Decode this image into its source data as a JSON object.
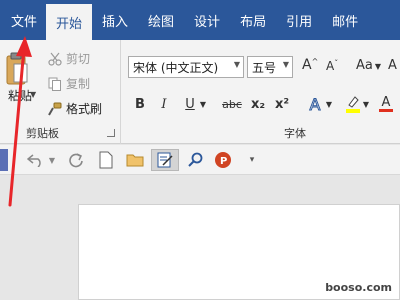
{
  "tabs": [
    {
      "label": "文件"
    },
    {
      "label": "开始"
    },
    {
      "label": "插入"
    },
    {
      "label": "绘图"
    },
    {
      "label": "设计"
    },
    {
      "label": "布局"
    },
    {
      "label": "引用"
    },
    {
      "label": "邮件"
    }
  ],
  "clipboard": {
    "paste_label": "粘贴",
    "cut_label": "剪切",
    "copy_label": "复制",
    "format_painter_label": "格式刷",
    "group_label": "剪贴板"
  },
  "font": {
    "font_name": "宋体 (中文正文)",
    "font_size": "五号",
    "grow_label": "A",
    "shrink_label": "A",
    "change_case_label": "Aa",
    "bold_label": "B",
    "italic_label": "I",
    "underline_label": "U",
    "strikethrough_label": "abc",
    "subscript_label": "x₂",
    "superscript_label": "x²",
    "text_effects_label": "A",
    "font_color_label": "A",
    "group_label": "字体"
  },
  "watermark": "booso.com",
  "colors": {
    "ribbon_blue": "#2b579a",
    "highlight_yellow": "#ffff00",
    "font_red": "#e0301e",
    "annotation_red": "#e8262a"
  }
}
